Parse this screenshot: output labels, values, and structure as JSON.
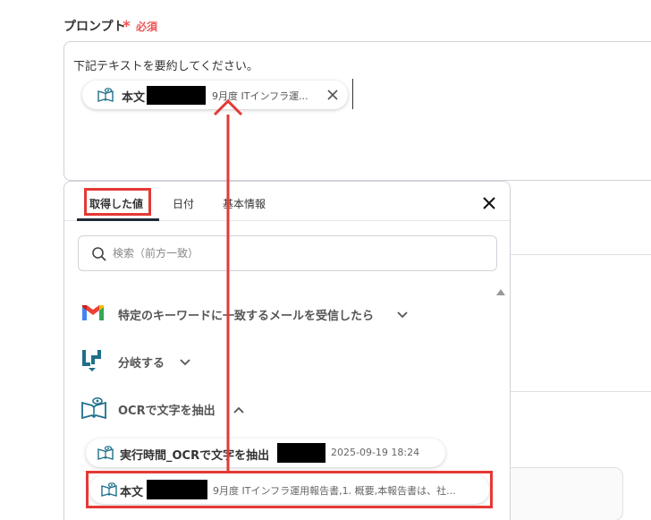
{
  "form": {
    "label": "プロンプト",
    "required_star": "*",
    "required_text": "必須",
    "prompt_text": "下記テキストを要約してください。",
    "chip": {
      "name": "本文",
      "value": "9月度 ITインフラ運..."
    }
  },
  "panel": {
    "tabs": [
      {
        "label": "取得した値",
        "active": true
      },
      {
        "label": "日付",
        "active": false
      },
      {
        "label": "基本情報",
        "active": false
      }
    ],
    "search": {
      "placeholder": "検索（前方一致）",
      "value": ""
    },
    "sections": [
      {
        "label": "特定のキーワードに一致するメールを受信したら",
        "icon": "gmail-icon",
        "expanded": false
      },
      {
        "label": "分岐する",
        "icon": "branch-icon",
        "expanded": false
      },
      {
        "label": "OCRで文字を抽出",
        "icon": "ocr-book-icon",
        "expanded": true
      }
    ],
    "items": [
      {
        "name": "実行時間_OCRで文字を抽出",
        "value": "2025-09-19 18:24"
      },
      {
        "name": "本文",
        "value": "9月度 ITインフラ運用報告書,1. 概要,本報告書は、社..."
      }
    ]
  },
  "colors": {
    "highlight": "#e53935",
    "required": "#ee5555",
    "branch": "#1f6f8b",
    "gmail_red": "#ea4335"
  }
}
